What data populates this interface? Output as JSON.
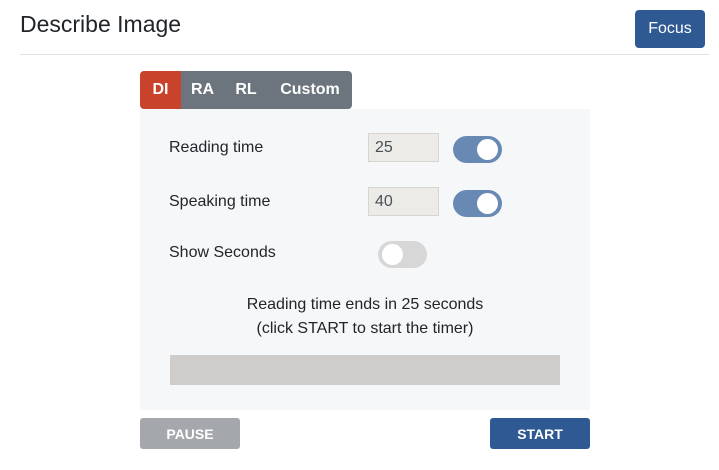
{
  "header": {
    "title": "Describe Image",
    "focus_label": "Focus"
  },
  "tabs": [
    {
      "label": "DI",
      "active": true
    },
    {
      "label": "RA",
      "active": false
    },
    {
      "label": "RL",
      "active": false
    },
    {
      "label": "Custom",
      "active": false
    }
  ],
  "settings": {
    "reading_time": {
      "label": "Reading time",
      "value": "25",
      "toggle_on": true
    },
    "speaking_time": {
      "label": "Speaking time",
      "value": "40",
      "toggle_on": true
    },
    "show_seconds": {
      "label": "Show Seconds",
      "toggle_on": false
    }
  },
  "status": {
    "line1": "Reading time ends in 25 seconds",
    "line2": "(click START to start the timer)"
  },
  "progress": {
    "value": 0
  },
  "controls": {
    "pause_label": "PAUSE",
    "start_label": "START"
  },
  "colors": {
    "active_tab": "#c9432c",
    "inactive_tab": "#6c757d",
    "primary": "#2f5993",
    "toggle_on": "#6989b5",
    "toggle_off": "#d7d7d7",
    "pause_button": "#a4a7ac"
  }
}
